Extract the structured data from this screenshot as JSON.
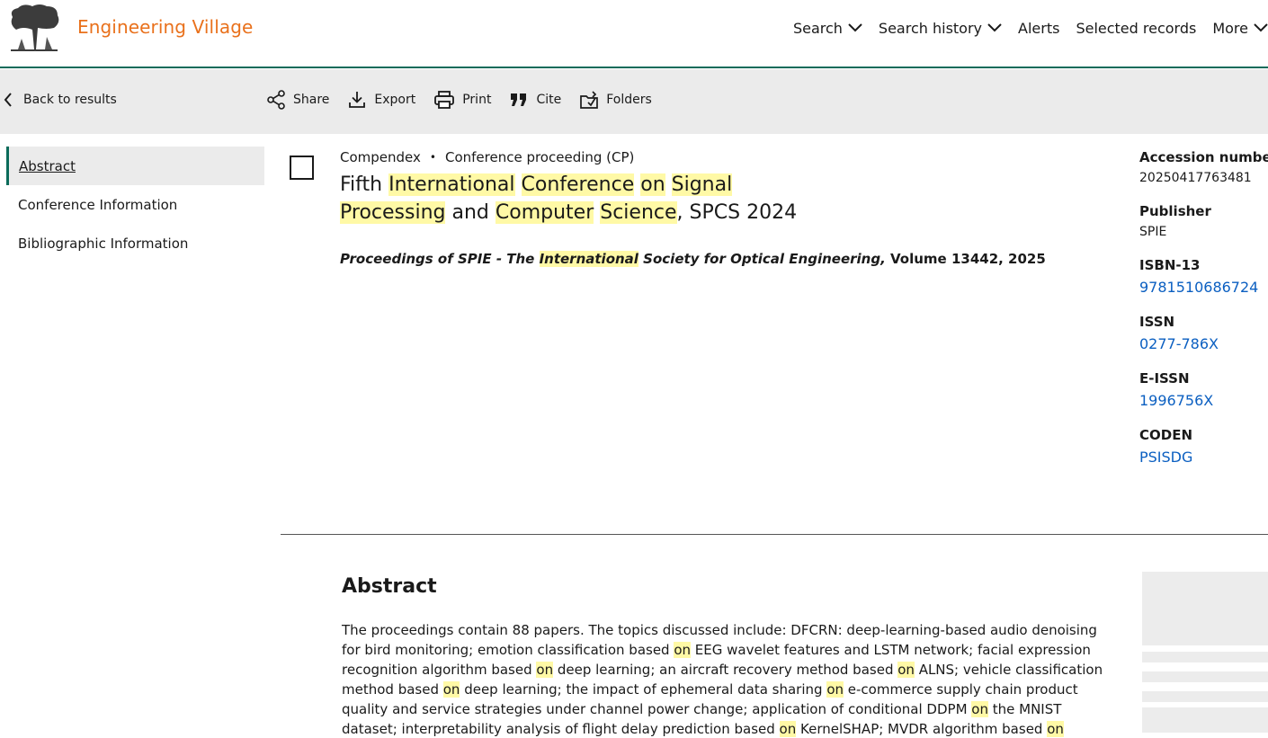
{
  "brand": {
    "name": "Engineering Village",
    "logo": "elsevier-tree-logo"
  },
  "nav": [
    {
      "label": "Search",
      "dropdown": true
    },
    {
      "label": "Search history",
      "dropdown": true
    },
    {
      "label": "Alerts",
      "dropdown": false
    },
    {
      "label": "Selected records",
      "dropdown": false
    },
    {
      "label": "More",
      "dropdown": true
    }
  ],
  "toolbar": {
    "back_label": "Back to results",
    "share_label": "Share",
    "export_label": "Export",
    "print_label": "Print",
    "cite_label": "Cite",
    "folders_label": "Folders"
  },
  "sidenav": {
    "items": [
      {
        "label": "Abstract",
        "active": true
      },
      {
        "label": "Conference Information",
        "active": false
      },
      {
        "label": "Bibliographic Information",
        "active": false
      }
    ]
  },
  "record": {
    "database": "Compendex",
    "doc_type": "Conference proceeding (CP)",
    "title_html": "Fifth <span class=\"hl\">International</span> <span class=\"hl\">Conference</span> <span class=\"hl\">on</span> <span class=\"hl\">Signal</span> <span class=\"hl\">Processing</span> and <span class=\"hl\">Computer</span> <span class=\"hl\">Science</span>, SPCS 2024",
    "source_pre": "Proceedings of SPIE - The ",
    "source_hl": "International",
    "source_post": " Society for Optical Engineering,",
    "volume": " Volume 13442, 2025"
  },
  "details": {
    "accession_label": "Accession number",
    "accession_value": "20250417763481",
    "publisher_label": "Publisher",
    "publisher_value": "SPIE",
    "isbn_label": "ISBN-13",
    "isbn_value": "9781510686724",
    "issn_label": "ISSN",
    "issn_value": "0277-786X",
    "eissn_label": "E-ISSN",
    "eissn_value": "1996756X",
    "coden_label": "CODEN",
    "coden_value": "PSISDG"
  },
  "abstract": {
    "heading": "Abstract",
    "text_html": "The proceedings contain 88 papers. The topics discussed include: DFCRN: deep-learning-based audio denoising for bird monitoring; emotion classification based <span class=\"hl\">on</span> EEG wavelet features and LSTM network; facial expression recognition algorithm based <span class=\"hl\">on</span> deep learning; an aircraft recovery method based <span class=\"hl\">on</span> ALNS; vehicle classification method based <span class=\"hl\">on</span> deep learning; the impact of ephemeral data sharing <span class=\"hl\">on</span> e-commerce supply chain product quality and service strategies under channel power change; application of conditional DDPM <span class=\"hl\">on</span> the MNIST dataset; interpretability analysis of flight delay prediction based <span class=\"hl\">on</span> KernelSHAP; MVDR algorithm based <span class=\"hl\">on</span>"
  },
  "colors": {
    "accent": "#0b6b5a",
    "brand": "#e9711c",
    "link": "#0b5fc1",
    "highlight": "#fff9a6"
  }
}
